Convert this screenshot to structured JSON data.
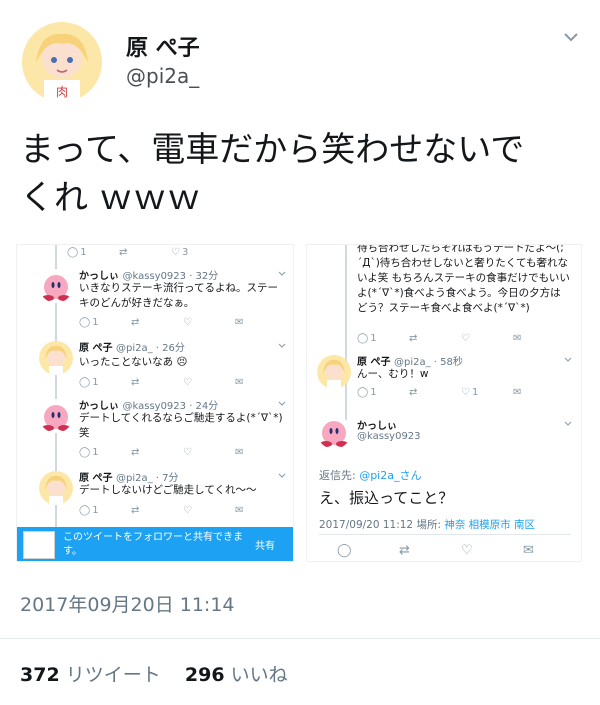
{
  "tweet": {
    "display_name": "原 ぺ子",
    "handle": "@pi2a_",
    "text_line1": "まって、電車だから笑わせないで",
    "text_line2": "くれ ｗｗｗ",
    "timestamp": "2017年09月20日 11:14",
    "retweets": "372",
    "retweets_label": "リツイート",
    "likes": "296",
    "likes_label": "いいね"
  },
  "left_panel": {
    "top_counts": {
      "reply": "1",
      "like": "3"
    },
    "items": [
      {
        "name": "かっしぃ",
        "meta": "@kassy0923 · 32分",
        "text": "いきなりステーキ流行ってるよね。ステーキのどんが好きだなぁ。",
        "reply": "1"
      },
      {
        "name": "原 ぺ子",
        "meta": "@pi2a_ · 26分",
        "text": "いったことないなあ 😣",
        "reply": "1"
      },
      {
        "name": "かっしぃ",
        "meta": "@kassy0923 · 24分",
        "text": "デートしてくれるならご馳走するよ(*ˊ∇ˋ*)笑",
        "reply": "1"
      },
      {
        "name": "原 ぺ子",
        "meta": "@pi2a_ · 7分",
        "text": "デートしないけどご馳走してくれ〜〜",
        "reply": "1"
      }
    ],
    "share_text": "このツイートをフォロワーと共有できます。",
    "share_button": "共有"
  },
  "right_panel": {
    "top_text": "待ち合わせしたらそれはもうデートだよ〜(;´Д`)待ち合わせしないと奢りたくても奢れないよ笑 もちろんステーキの食事だけでもいいよ(*ˊ∇ˋ*)食べよう食べよう。今日の夕方はどう？ステーキ食べよ食べよ(*ˊ∇ˋ*)",
    "top_counts": {
      "reply": "1"
    },
    "item": {
      "name": "原 ぺ子",
      "meta": "@pi2a_ · 58秒",
      "text": "んー、むり！w",
      "reply": "1",
      "like": "1"
    },
    "focus": {
      "name": "かっしぃ",
      "handle": "@kassy0923",
      "reply_to_prefix": "返信先: ",
      "reply_to_handle": "@pi2a_さん",
      "text": "え、振込ってこと？",
      "date": "2017/09/20 11:12 場所: ",
      "place": "神奈 相模原市 南区"
    }
  }
}
